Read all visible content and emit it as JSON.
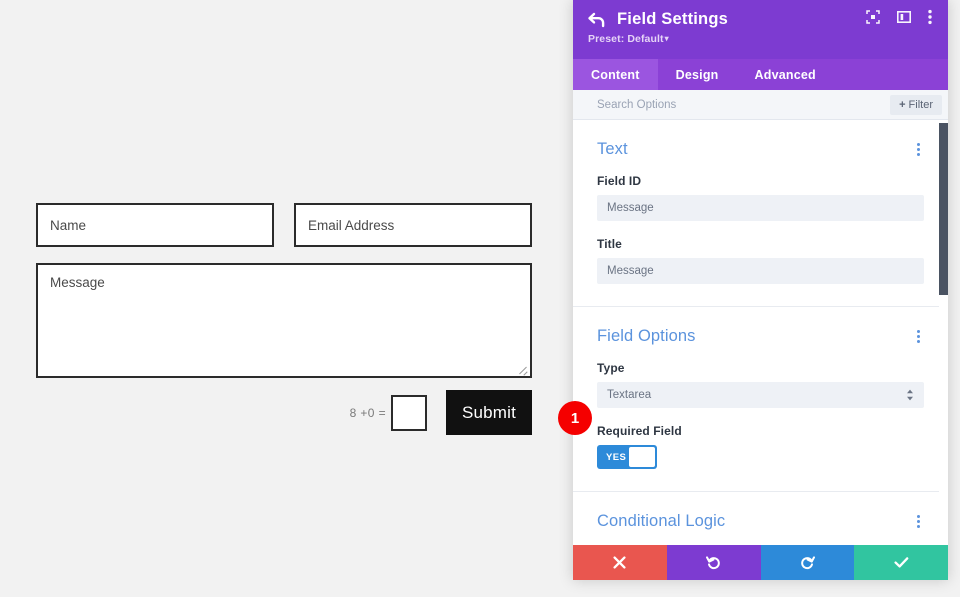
{
  "preview": {
    "fields": [
      {
        "name": "name-input",
        "placeholder": "Name"
      },
      {
        "name": "email-input",
        "placeholder": "Email Address"
      }
    ],
    "message_placeholder": "Message",
    "captcha_label": "8 +0 =",
    "submit_label": "Submit"
  },
  "panel": {
    "header": {
      "title": "Field Settings",
      "preset": "Preset: Default",
      "preset_caret": "▾",
      "icons": [
        {
          "name": "expand-view-icon"
        },
        {
          "name": "panel-layout-icon"
        },
        {
          "name": "more-options-icon"
        }
      ],
      "back_icon": "back-arrow-icon"
    },
    "tabs": [
      {
        "label": "Content",
        "active": true
      },
      {
        "label": "Design",
        "active": false
      },
      {
        "label": "Advanced",
        "active": false
      }
    ],
    "search": {
      "placeholder": "Search Options",
      "filter_label": "Filter",
      "filter_plus": "+"
    },
    "sections": [
      {
        "title": "Text",
        "options": [
          {
            "label": "Field ID",
            "value": "Message",
            "control": "text"
          },
          {
            "label": "Title",
            "value": "Message",
            "control": "text"
          }
        ]
      },
      {
        "title": "Field Options",
        "options": [
          {
            "label": "Type",
            "value": "Textarea",
            "control": "select"
          },
          {
            "label": "Required Field",
            "value": "YES",
            "control": "toggle"
          }
        ]
      },
      {
        "title": "Conditional Logic",
        "options": []
      }
    ],
    "footer": [
      {
        "name": "cancel-button",
        "icon": "✖",
        "color": "#e9564f"
      },
      {
        "name": "undo-button",
        "icon": "↺",
        "color": "#7d3bd1"
      },
      {
        "name": "redo-button",
        "icon": "↻",
        "color": "#2d8ad9"
      },
      {
        "name": "save-button",
        "icon": "✔",
        "color": "#31c5a0"
      }
    ]
  },
  "callout": {
    "number": "1"
  },
  "colors": {
    "header_purple": "#7d3bd1",
    "tab_purple": "#8b41d6",
    "tab_active_purple": "#9b55e0",
    "section_title_blue": "#5b93dd",
    "toggle_blue": "#2d8ad9",
    "badge_red": "#f50000"
  }
}
